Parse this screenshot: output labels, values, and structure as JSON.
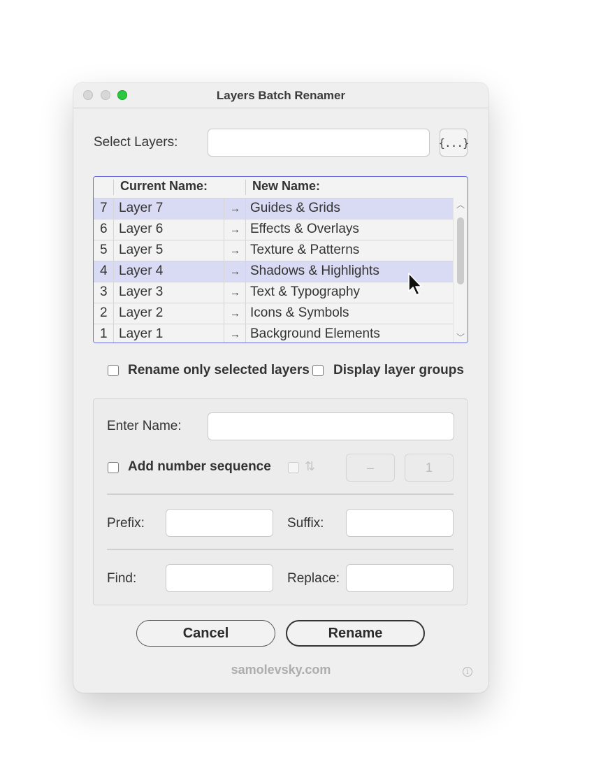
{
  "window": {
    "title": "Layers Batch Renamer"
  },
  "select_layers": {
    "label": "Select Layers:",
    "value": "",
    "brace_label": "{...}"
  },
  "table": {
    "header_current": "Current Name:",
    "header_new": "New Name:",
    "arrow": "→",
    "rows": [
      {
        "num": "7",
        "current": "Layer 7",
        "new": "Guides & Grids",
        "selected": true
      },
      {
        "num": "6",
        "current": "Layer 6",
        "new": "Effects & Overlays",
        "selected": false
      },
      {
        "num": "5",
        "current": "Layer 5",
        "new": "Texture & Patterns",
        "selected": false
      },
      {
        "num": "4",
        "current": "Layer 4",
        "new": "Shadows & Highlights",
        "selected": true
      },
      {
        "num": "3",
        "current": "Layer 3",
        "new": "Text & Typography",
        "selected": false
      },
      {
        "num": "2",
        "current": "Layer 2",
        "new": "Icons & Symbols",
        "selected": false
      },
      {
        "num": "1",
        "current": "Layer 1",
        "new": "Background Elements",
        "selected": false
      }
    ]
  },
  "options": {
    "rename_selected": "Rename only selected layers",
    "display_groups": "Display layer groups"
  },
  "rename": {
    "enter_name_label": "Enter Name:",
    "enter_name_value": "",
    "add_sequence_label": "Add number sequence",
    "sequence_step": "–",
    "sequence_start": "1",
    "prefix_label": "Prefix:",
    "suffix_label": "Suffix:",
    "find_label": "Find:",
    "replace_label": "Replace:"
  },
  "buttons": {
    "cancel": "Cancel",
    "rename": "Rename"
  },
  "footer": {
    "site": "samolevsky.com",
    "info_glyph": "i"
  },
  "colors": {
    "accent": "#6a6ee0",
    "selected_row": "#d9daf3",
    "zoom_light": "#2ac73f"
  }
}
